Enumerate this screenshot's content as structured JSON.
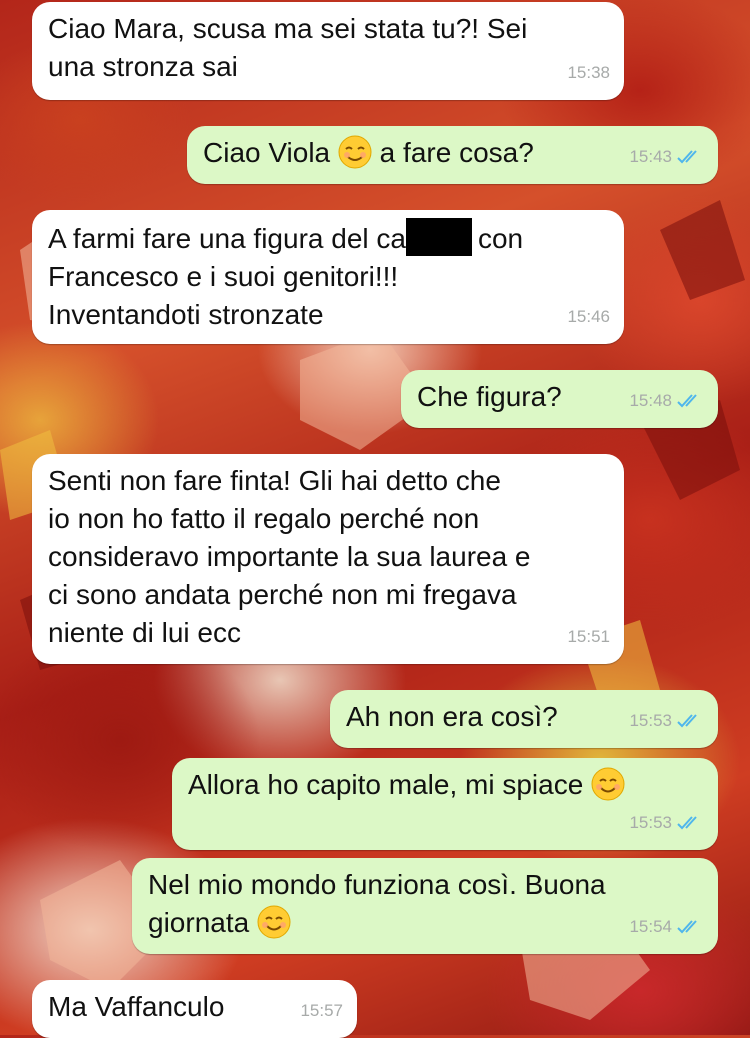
{
  "messages": [
    {
      "dir": "in",
      "lines": [
        "Ciao Mara, scusa ma sei stata tu?! Sei",
        "una stronza sai"
      ],
      "time": "15:38"
    },
    {
      "dir": "out",
      "before": "Ciao Viola ",
      "emoji": "relieved-face-icon",
      "after": " a fare cosa?",
      "time": "15:43"
    },
    {
      "dir": "in",
      "lines": [
        "A farmi fare una figura del ca",
        "con",
        "Francesco e i suoi genitori!!!",
        "Inventandoti stronzate"
      ],
      "time": "15:46"
    },
    {
      "dir": "out",
      "text": "Che figura?",
      "time": "15:48"
    },
    {
      "dir": "in",
      "lines": [
        "Senti non fare finta! Gli hai detto che",
        "io non ho fatto il regalo perché non",
        "consideravo importante la sua laurea e",
        "ci sono andata perché non mi fregava",
        "niente di lui ecc"
      ],
      "time": "15:51"
    },
    {
      "dir": "out",
      "text": "Ah non era così?",
      "time": "15:53"
    },
    {
      "dir": "out",
      "before": "Allora ho capito male, mi spiace ",
      "emoji": "smiling-face-icon",
      "time": "15:53"
    },
    {
      "dir": "out",
      "lines": [
        "Nel mio mondo funziona così. Buona",
        "giornata "
      ],
      "emoji": "smiling-face-icon",
      "time": "15:54"
    },
    {
      "dir": "in",
      "text": "Ma Vaffanculo",
      "time": "15:57"
    }
  ],
  "colors": {
    "incoming": "#ffffff",
    "outgoing": "#dcf8c6",
    "ticks": "#4fb6ec",
    "time": "#a7aaa9"
  }
}
